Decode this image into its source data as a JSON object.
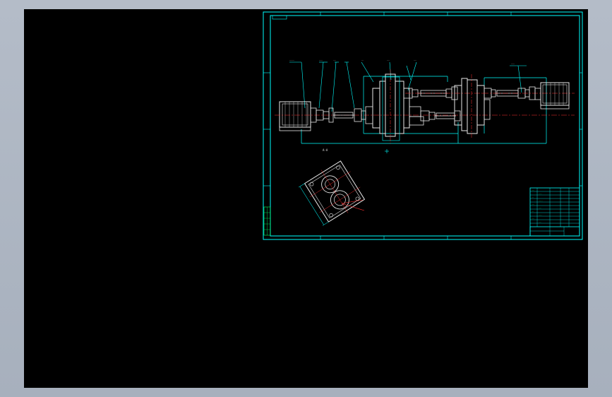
{
  "viewer": {
    "background_color": "#000000",
    "frame_color": "#00ffff"
  },
  "drawing": {
    "section_label": "A-A",
    "title_block_caption": "",
    "sheet_tag": ""
  },
  "colors": {
    "frame": "#00ffff",
    "geometry": "#e8e8e8",
    "centerline": "#ff3030",
    "dimension": "#00ff66",
    "annotation": "#ffff00"
  }
}
